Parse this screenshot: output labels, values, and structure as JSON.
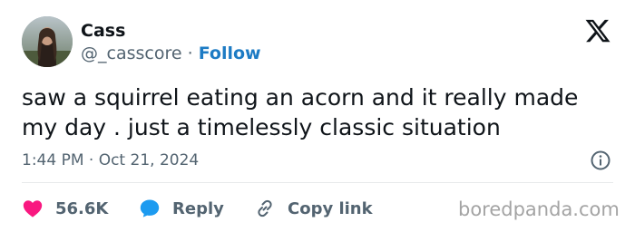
{
  "author": {
    "name": "Cass",
    "handle": "@_casscore",
    "separator": "·",
    "follow_label": "Follow"
  },
  "tweet": {
    "text": "saw a squirrel eating an acorn and it really made my day . just a timelessly classic situation",
    "timestamp": "1:44 PM · Oct 21, 2024"
  },
  "actions": {
    "like_count": "56.6K",
    "reply_label": "Reply",
    "copy_link_label": "Copy link"
  },
  "watermark": "boredpanda.com",
  "icons": {
    "brand": "x-logo-icon",
    "info": "info-icon",
    "like": "heart-icon",
    "reply": "speech-bubble-icon",
    "copy": "link-icon"
  },
  "colors": {
    "accent": "#1d7bc4",
    "like": "#f91880",
    "reply": "#1d9bf0",
    "muted": "#536471",
    "text": "#0f1419"
  }
}
